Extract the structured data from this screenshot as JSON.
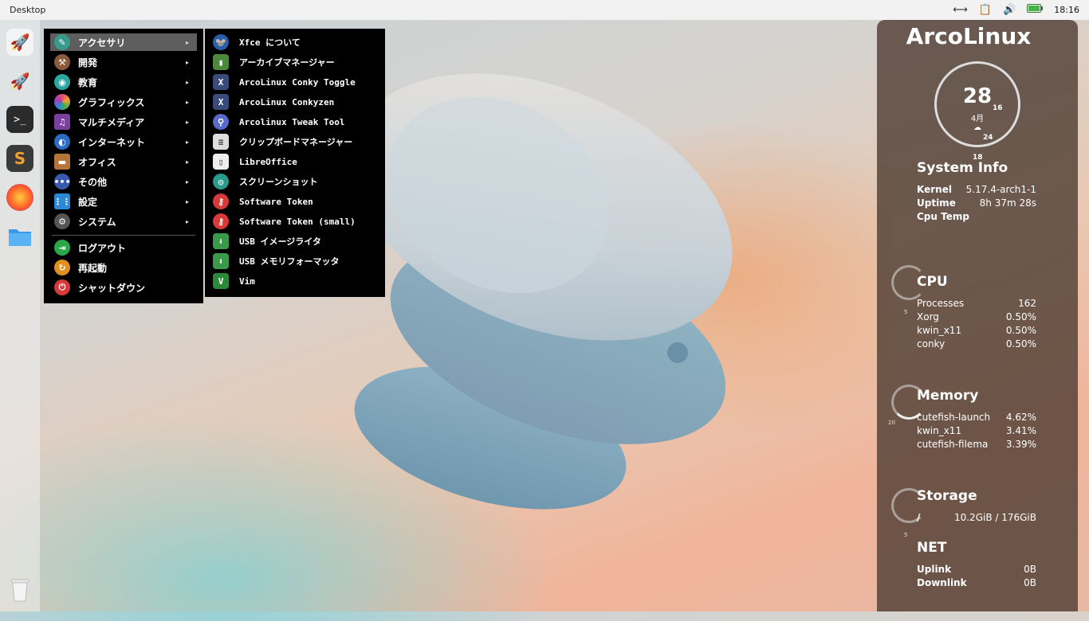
{
  "topbar": {
    "title": "Desktop",
    "clock": "18:16",
    "tray_icons": [
      "network-arrows-icon",
      "clipboard-icon",
      "volume-icon",
      "battery-icon"
    ]
  },
  "dock": {
    "items": [
      "launcher-rocket-icon",
      "launcher-rocket-icon",
      "terminal-icon",
      "sublime-text-icon",
      "firefox-icon",
      "file-manager-icon"
    ],
    "trash": "trash-icon"
  },
  "menu": {
    "categories": [
      {
        "label": "アクセサリ",
        "icon": "accessories-icon",
        "color": "#3a9a8a",
        "arrow": "▸"
      },
      {
        "label": "開発",
        "icon": "development-icon",
        "color": "#8a5a3a",
        "arrow": "▸"
      },
      {
        "label": "教育",
        "icon": "education-icon",
        "color": "#2aa7a0",
        "arrow": "▸"
      },
      {
        "label": "グラフィックス",
        "icon": "graphics-icon",
        "color": "#e04f6a",
        "arrow": "▸"
      },
      {
        "label": "マルチメディア",
        "icon": "multimedia-icon",
        "color": "#7b3fa0",
        "arrow": "▸"
      },
      {
        "label": "インターネット",
        "icon": "internet-icon",
        "color": "#2b6cc4",
        "arrow": "▸"
      },
      {
        "label": "オフィス",
        "icon": "office-icon",
        "color": "#b5743a",
        "arrow": "▸"
      },
      {
        "label": "その他",
        "icon": "other-icon",
        "color": "#3a5ab0",
        "arrow": "▸"
      },
      {
        "label": "設定",
        "icon": "settings-icon",
        "color": "#2a8ad8",
        "arrow": "▸"
      },
      {
        "label": "システム",
        "icon": "system-icon",
        "color": "#555555",
        "arrow": "▸"
      }
    ],
    "session": [
      {
        "label": "ログアウト",
        "icon": "logout-icon",
        "color": "#2aa84a"
      },
      {
        "label": "再起動",
        "icon": "restart-icon",
        "color": "#e09020"
      },
      {
        "label": "シャットダウン",
        "icon": "shutdown-icon",
        "color": "#d83a3a"
      }
    ],
    "submenu": [
      {
        "label": "Xfce について",
        "icon": "xfce-icon",
        "color": "#2b5ea8"
      },
      {
        "label": "アーカイブマネージャー",
        "icon": "archive-manager-icon",
        "color": "#4a8a3a"
      },
      {
        "label": "ArcoLinux Conky Toggle",
        "icon": "conky-toggle-icon",
        "color": "#3a4a7a"
      },
      {
        "label": "ArcoLinux Conkyzen",
        "icon": "conkyzen-icon",
        "color": "#3a4a7a"
      },
      {
        "label": "Arcolinux Tweak Tool",
        "icon": "tweak-tool-icon",
        "color": "#5a6ac8"
      },
      {
        "label": "クリップボードマネージャー",
        "icon": "clipboard-manager-icon",
        "color": "#dddddd"
      },
      {
        "label": "LibreOffice",
        "icon": "libreoffice-icon",
        "color": "#eeeeee"
      },
      {
        "label": "スクリーンショット",
        "icon": "screenshot-icon",
        "color": "#2a9a8a"
      },
      {
        "label": "Software Token",
        "icon": "software-token-icon",
        "color": "#d83a3a"
      },
      {
        "label": "Software Token (small)",
        "icon": "software-token-small-icon",
        "color": "#d83a3a"
      },
      {
        "label": "USB イメージライタ",
        "icon": "usb-image-writer-icon",
        "color": "#3a9a4a"
      },
      {
        "label": "USB メモリフォーマッタ",
        "icon": "usb-formatter-icon",
        "color": "#3a9a4a"
      },
      {
        "label": "Vim",
        "icon": "vim-icon",
        "color": "#2a8a3a"
      }
    ]
  },
  "conky": {
    "brand": "ArcoLinux",
    "clock": {
      "minute": "28",
      "sub": "4月",
      "icon": "weather-icon",
      "labels": [
        "16",
        "24",
        "18"
      ]
    },
    "system": {
      "title": "System Info",
      "rows": [
        {
          "k": "Kernel",
          "v": "5.17.4-arch1-1"
        },
        {
          "k": "Uptime",
          "v": "8h 37m 28s"
        },
        {
          "k": "Cpu Temp",
          "v": ""
        }
      ]
    },
    "cpu": {
      "title": "CPU",
      "gauge_label": "5",
      "rows": [
        {
          "k": "Processes",
          "v": "162"
        },
        {
          "k": "Xorg",
          "v": "0.50%"
        },
        {
          "k": "kwin_x11",
          "v": "0.50%"
        },
        {
          "k": "conky",
          "v": "0.50%"
        }
      ]
    },
    "memory": {
      "title": "Memory",
      "gauge_label": "20",
      "rows": [
        {
          "k": "cutefish-launch",
          "v": "4.62%"
        },
        {
          "k": "kwin_x11",
          "v": "3.41%"
        },
        {
          "k": "cutefish-filema",
          "v": "3.39%"
        }
      ]
    },
    "storage": {
      "title": "Storage",
      "gauge_label": "5",
      "rows": [
        {
          "k": "/",
          "v": "10.2GiB / 176GiB"
        }
      ]
    },
    "net": {
      "title": "NET",
      "rows": [
        {
          "k": "Uplink",
          "v": "0B"
        },
        {
          "k": "Downlink",
          "v": "0B"
        }
      ]
    }
  }
}
